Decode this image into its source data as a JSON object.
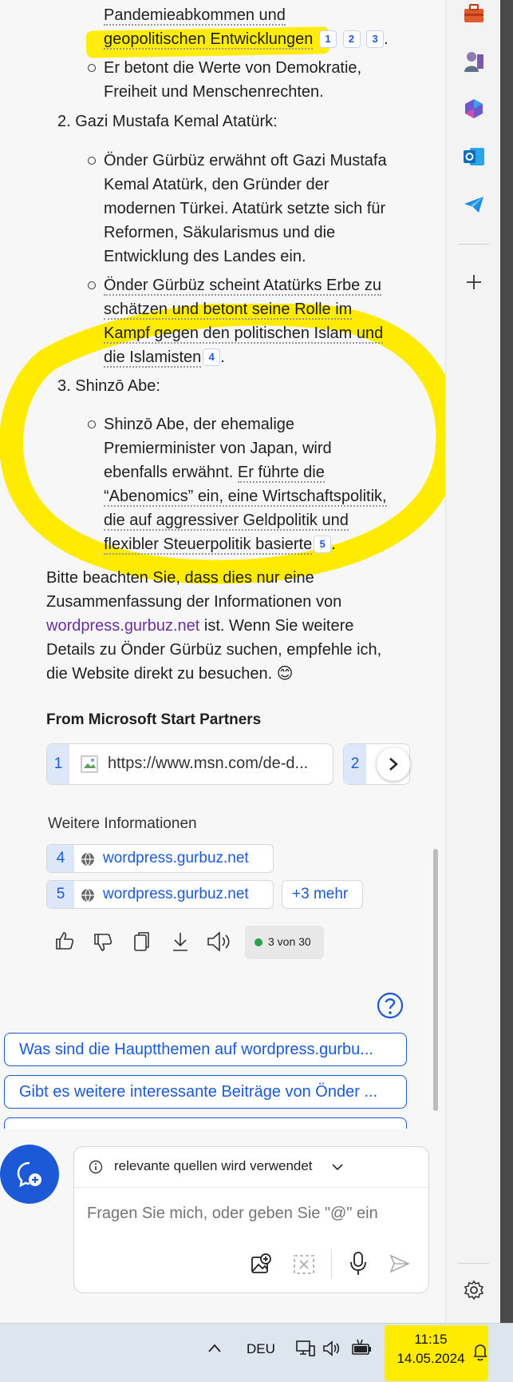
{
  "answer": {
    "top_line1": "Pandemieabkommen und",
    "top_line2": "geopolitischen Entwicklungen",
    "top_cites": [
      "1",
      "2",
      "3"
    ],
    "top_dot": ".",
    "bullet_values_1": "Er betont die Werte von Demokratie,",
    "bullet_values_2": "Freiheit und Menschenrechten.",
    "item2_heading": "2. Gazi Mustafa Kemal Atatürk:",
    "item2_b1": [
      "Önder Gürbüz erwähnt oft Gazi Mustafa",
      "Kemal Atatürk, den Gründer der",
      "modernen Türkei. Atatürk setzte sich für",
      "Reformen, Säkularismus und die",
      "Entwicklung des Landes ein."
    ],
    "item2_b2": [
      "Önder Gürbüz scheint Atatürks Erbe zu",
      "schätzen und betont seine Rolle im",
      "Kampf gegen den politischen Islam und",
      "die Islamisten"
    ],
    "item2_b2_cite": "4",
    "item2_b2_dot": ".",
    "item3_heading": "3. Shinzō Abe:",
    "item3_b1_plain_1": "Shinzō Abe, der ehemalige",
    "item3_b1_plain_2": "Premierminister von Japan, wird",
    "item3_b1_plain_3a": "ebenfalls erwähnt. ",
    "item3_b1_ul_3b": "Er führte die",
    "item3_b1_ul_4": "“Abenomics” ein, eine Wirtschaftspolitik,",
    "item3_b1_ul_5": "die auf aggressiver Geldpolitik und",
    "item3_b1_ul_6": "flexibler Steuerpolitik basierte",
    "item3_b1_cite": "5",
    "item3_b1_dot": ".",
    "closing_1": "Bitte beachten Sie, dass dies nur eine",
    "closing_2": "Zusammenfassung der Informationen von",
    "closing_link": "wordpress.gurbuz.net",
    "closing_3_rest": " ist. Wenn Sie weitere",
    "closing_4": "Details zu Önder Gürbüz suchen, empfehle ich,",
    "closing_5": "die Website direkt zu besuchen. 😊"
  },
  "partners": {
    "heading": "From Microsoft Start Partners",
    "card1_num": "1",
    "card1_url": "https://www.msn.com/de-d...",
    "card2_num": "2"
  },
  "more_info": {
    "heading": "Weitere Informationen",
    "sources": [
      {
        "num": "4",
        "label": "wordpress.gurbuz.net"
      },
      {
        "num": "5",
        "label": "wordpress.gurbuz.net"
      }
    ],
    "more_label": "+3 mehr"
  },
  "actions": {
    "counter": "3 von 30"
  },
  "suggestions": [
    "Was sind die Hauptthemen auf wordpress.gurbu...",
    "Gibt es weitere interessante Beiträge von Önder ..."
  ],
  "composer": {
    "source_mode": "relevante quellen wird verwendet",
    "placeholder": "Fragen Sie mich, oder geben Sie \"@\" ein"
  },
  "taskbar": {
    "language": "DEU",
    "time": "11:15",
    "date": "14.05.2024"
  },
  "colors": {
    "accent": "#1b59d6",
    "highlight": "#ffeb00",
    "link_visited": "#6b2fa0"
  }
}
